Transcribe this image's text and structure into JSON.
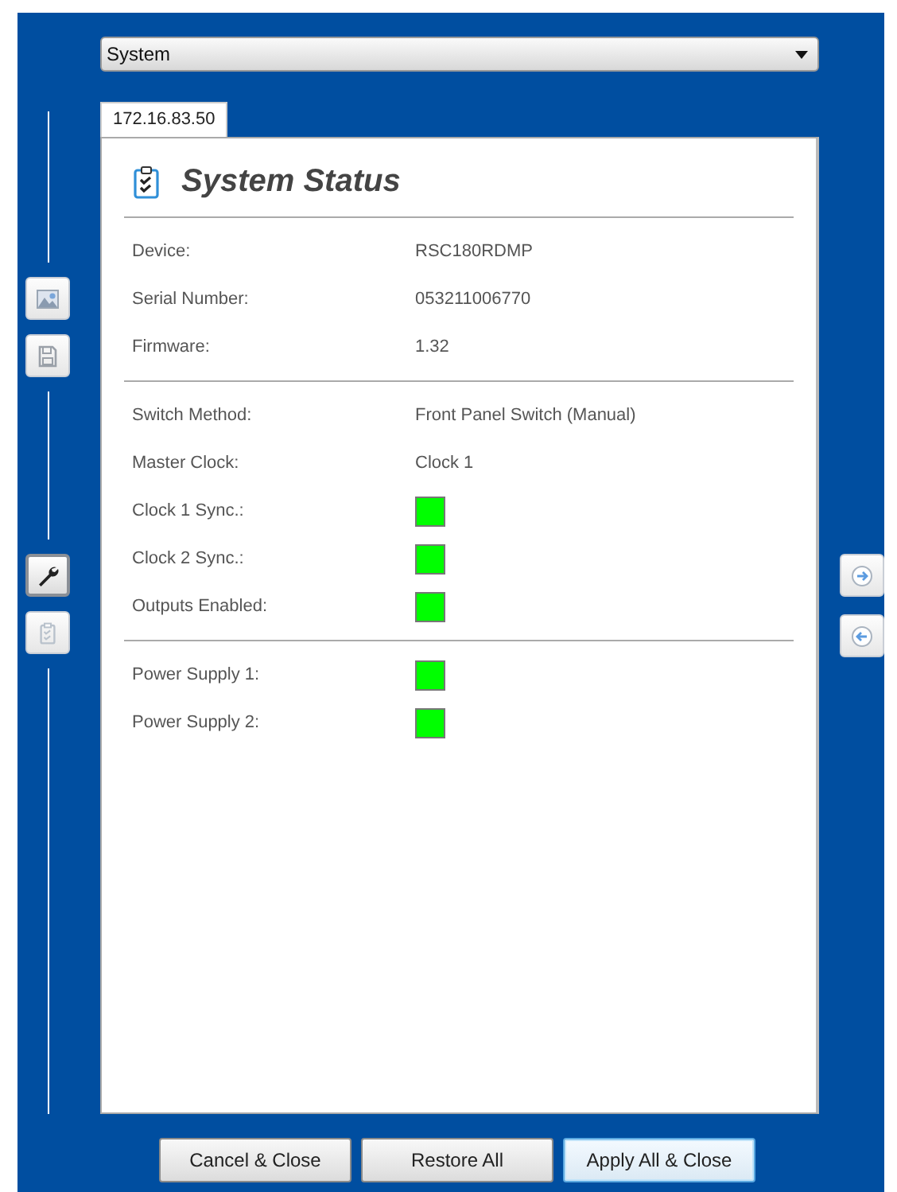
{
  "selector": {
    "value": "System"
  },
  "tabs": [
    {
      "label": "172.16.83.50",
      "selected": true
    }
  ],
  "left_toolbar": [
    {
      "kind": "image",
      "selected": false
    },
    {
      "kind": "save",
      "selected": false
    },
    {
      "kind": "wrench",
      "selected": true
    },
    {
      "kind": "clipboard",
      "selected": false
    }
  ],
  "right_toolbar": [
    {
      "kind": "forward"
    },
    {
      "kind": "back"
    }
  ],
  "panel": {
    "title": "System Status",
    "sections": [
      {
        "rows": [
          {
            "label": "Device:",
            "kind": "text",
            "value": "RSC180RDMP"
          },
          {
            "label": "Serial Number:",
            "kind": "text",
            "value": "053211006770"
          },
          {
            "label": "Firmware:",
            "kind": "text",
            "value": "1.32"
          }
        ]
      },
      {
        "rows": [
          {
            "label": "Switch Method:",
            "kind": "text",
            "value": "Front Panel Switch (Manual)"
          },
          {
            "label": "Master Clock:",
            "kind": "text",
            "value": "Clock 1"
          },
          {
            "label": "Clock 1 Sync.:",
            "kind": "indicator",
            "color": "#00ff00"
          },
          {
            "label": "Clock 2 Sync.:",
            "kind": "indicator",
            "color": "#00ff00"
          },
          {
            "label": "Outputs Enabled:",
            "kind": "indicator",
            "color": "#00ff00"
          }
        ]
      },
      {
        "rows": [
          {
            "label": "Power Supply 1:",
            "kind": "indicator",
            "color": "#00ff00"
          },
          {
            "label": "Power Supply 2:",
            "kind": "indicator",
            "color": "#00ff00"
          }
        ]
      }
    ]
  },
  "buttons": [
    {
      "label": "Cancel & Close",
      "selected": false
    },
    {
      "label": "Restore All",
      "selected": false
    },
    {
      "label": "Apply All & Close",
      "selected": true
    }
  ]
}
